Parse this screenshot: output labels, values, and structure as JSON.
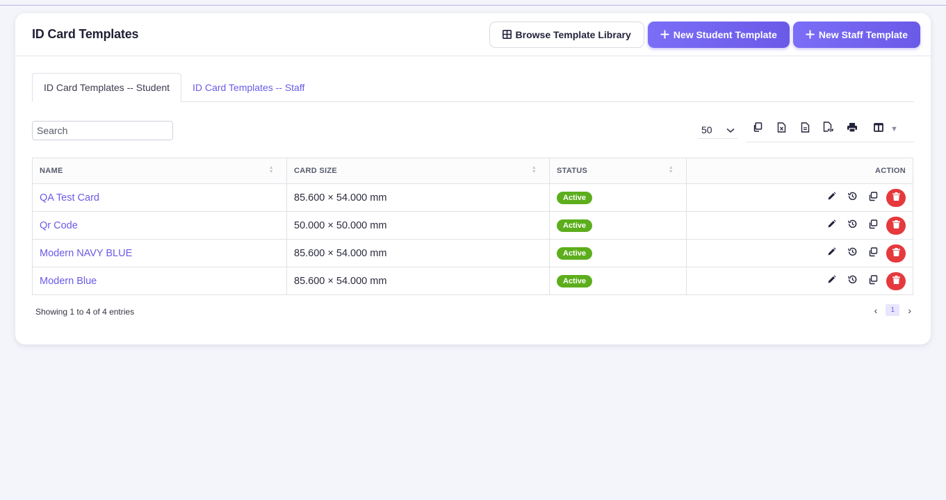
{
  "header": {
    "title": "ID Card Templates",
    "browse_label": "Browse Template Library",
    "new_student_label": "New Student Template",
    "new_staff_label": "New Staff Template"
  },
  "tabs": [
    {
      "label": "ID Card Templates -- Student",
      "active": true
    },
    {
      "label": "ID Card Templates -- Staff",
      "active": false
    }
  ],
  "search": {
    "placeholder": "Search",
    "value": ""
  },
  "page_size": {
    "value": "50"
  },
  "table": {
    "columns": [
      "NAME",
      "CARD SIZE",
      "STATUS",
      "ACTION"
    ],
    "rows": [
      {
        "name": "QA Test Card",
        "size": "85.600 × 54.000 mm",
        "status": "Active"
      },
      {
        "name": "Qr Code",
        "size": "50.000 × 50.000 mm",
        "status": "Active"
      },
      {
        "name": "Modern NAVY BLUE",
        "size": "85.600 × 54.000 mm",
        "status": "Active"
      },
      {
        "name": "Modern Blue",
        "size": "85.600 × 54.000 mm",
        "status": "Active"
      }
    ]
  },
  "footer": {
    "info": "Showing 1 to 4 of 4 entries",
    "current_page": "1",
    "prev": "‹",
    "next": "›"
  },
  "colors": {
    "accent": "#6a5ae8",
    "active_badge": "#5cae1c",
    "delete": "#e5393d"
  }
}
